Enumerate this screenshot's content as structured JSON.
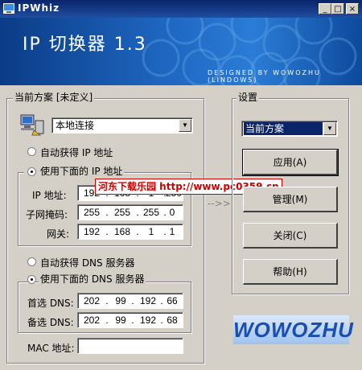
{
  "window": {
    "title": "IPWhiz",
    "btn_min": "_",
    "btn_max": "□",
    "btn_close": "×"
  },
  "banner": {
    "title": "IP 切换器 1.3",
    "subtitle": "DESIGNED BY WOWOZHU (LINDOWS)"
  },
  "left": {
    "group_title": "当前方案 [未定义]",
    "adapter": "本地连接",
    "ip_auto": "自动获得 IP 地址",
    "ip_manual": "使用下面的 IP 地址",
    "ip_label": "IP 地址:",
    "ip_value": [
      "192",
      "168",
      "1",
      "250"
    ],
    "mask_label": "子网掩码:",
    "mask_value": [
      "255",
      "255",
      "255",
      "0"
    ],
    "gw_label": "网关:",
    "gw_value": [
      "192",
      "168",
      "1",
      "1"
    ],
    "dns_auto": "自动获得 DNS 服务器",
    "dns_manual": "使用下面的 DNS 服务器",
    "dns1_label": "首选 DNS:",
    "dns1_value": [
      "202",
      "99",
      "192",
      "66"
    ],
    "dns2_label": "备选 DNS:",
    "dns2_value": [
      "202",
      "99",
      "192",
      "68"
    ],
    "mac_label": "MAC 地址:",
    "mac_value": ""
  },
  "arrow": "-->>",
  "right": {
    "group_title": "设置",
    "scheme": "当前方案",
    "btn_apply": "应用(A)",
    "btn_manage": "管理(M)",
    "btn_close": "关闭(C)",
    "btn_help": "帮助(H)"
  },
  "watermark": "河东下载乐园 http://www.pc0359.cn",
  "logo": "WOWOZHU"
}
